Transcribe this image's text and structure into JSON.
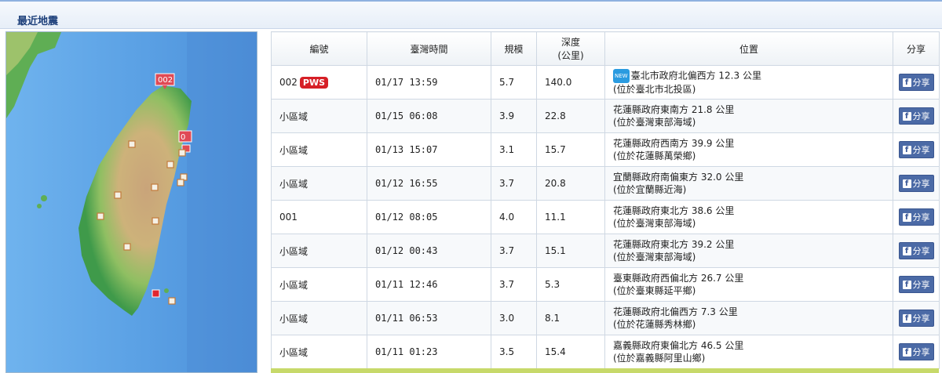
{
  "header": {
    "title": "最近地震"
  },
  "map": {
    "marker_label": "002",
    "marker_label2": "0"
  },
  "table": {
    "headers": {
      "id": "編號",
      "time": "臺灣時間",
      "magnitude": "規模",
      "depth_line1": "深度",
      "depth_line2": "(公里)",
      "location": "位置",
      "share": "分享"
    },
    "rows": [
      {
        "id": "002",
        "pws": "PWS",
        "time": "01/17 13:59",
        "mag": "5.7",
        "depth": "140.0",
        "new": "NEW",
        "loc1": "臺北市政府北偏西方 12.3 公里",
        "loc2": "(位於臺北市北投區)",
        "share": "分享"
      },
      {
        "id": "小區域",
        "time": "01/15 06:08",
        "mag": "3.9",
        "depth": "22.8",
        "loc1": "花蓮縣政府東南方 21.8 公里",
        "loc2": "(位於臺灣東部海域)",
        "share": "分享"
      },
      {
        "id": "小區域",
        "time": "01/13 15:07",
        "mag": "3.1",
        "depth": "15.7",
        "loc1": "花蓮縣政府西南方 39.9 公里",
        "loc2": "(位於花蓮縣萬榮鄉)",
        "share": "分享"
      },
      {
        "id": "小區域",
        "time": "01/12 16:55",
        "mag": "3.7",
        "depth": "20.8",
        "loc1": "宜蘭縣政府南偏東方 32.0 公里",
        "loc2": "(位於宜蘭縣近海)",
        "share": "分享"
      },
      {
        "id": "001",
        "time": "01/12 08:05",
        "mag": "4.0",
        "depth": "11.1",
        "loc1": "花蓮縣政府東北方 38.6 公里",
        "loc2": "(位於臺灣東部海域)",
        "share": "分享"
      },
      {
        "id": "小區域",
        "time": "01/12 00:43",
        "mag": "3.7",
        "depth": "15.1",
        "loc1": "花蓮縣政府東北方 39.2 公里",
        "loc2": "(位於臺灣東部海域)",
        "share": "分享"
      },
      {
        "id": "小區域",
        "time": "01/11 12:46",
        "mag": "3.7",
        "depth": "5.3",
        "loc1": "臺東縣政府西偏北方 26.7 公里",
        "loc2": "(位於臺東縣延平鄉)",
        "share": "分享"
      },
      {
        "id": "小區域",
        "time": "01/11 06:53",
        "mag": "3.0",
        "depth": "8.1",
        "loc1": "花蓮縣政府北偏西方 7.3 公里",
        "loc2": "(位於花蓮縣秀林鄉)",
        "share": "分享"
      },
      {
        "id": "小區域",
        "time": "01/11 01:23",
        "mag": "3.5",
        "depth": "15.4",
        "loc1": "嘉義縣政府東偏北方 46.5 公里",
        "loc2": "(位於嘉義縣阿里山鄉)",
        "share": "分享"
      }
    ]
  },
  "colors": {
    "pws": "#d61f26",
    "share_button": "#4b6aa6",
    "accent_bar": "#c7d96a",
    "header_text": "#1c3f7a"
  },
  "icons": {
    "share": "facebook-icon"
  }
}
